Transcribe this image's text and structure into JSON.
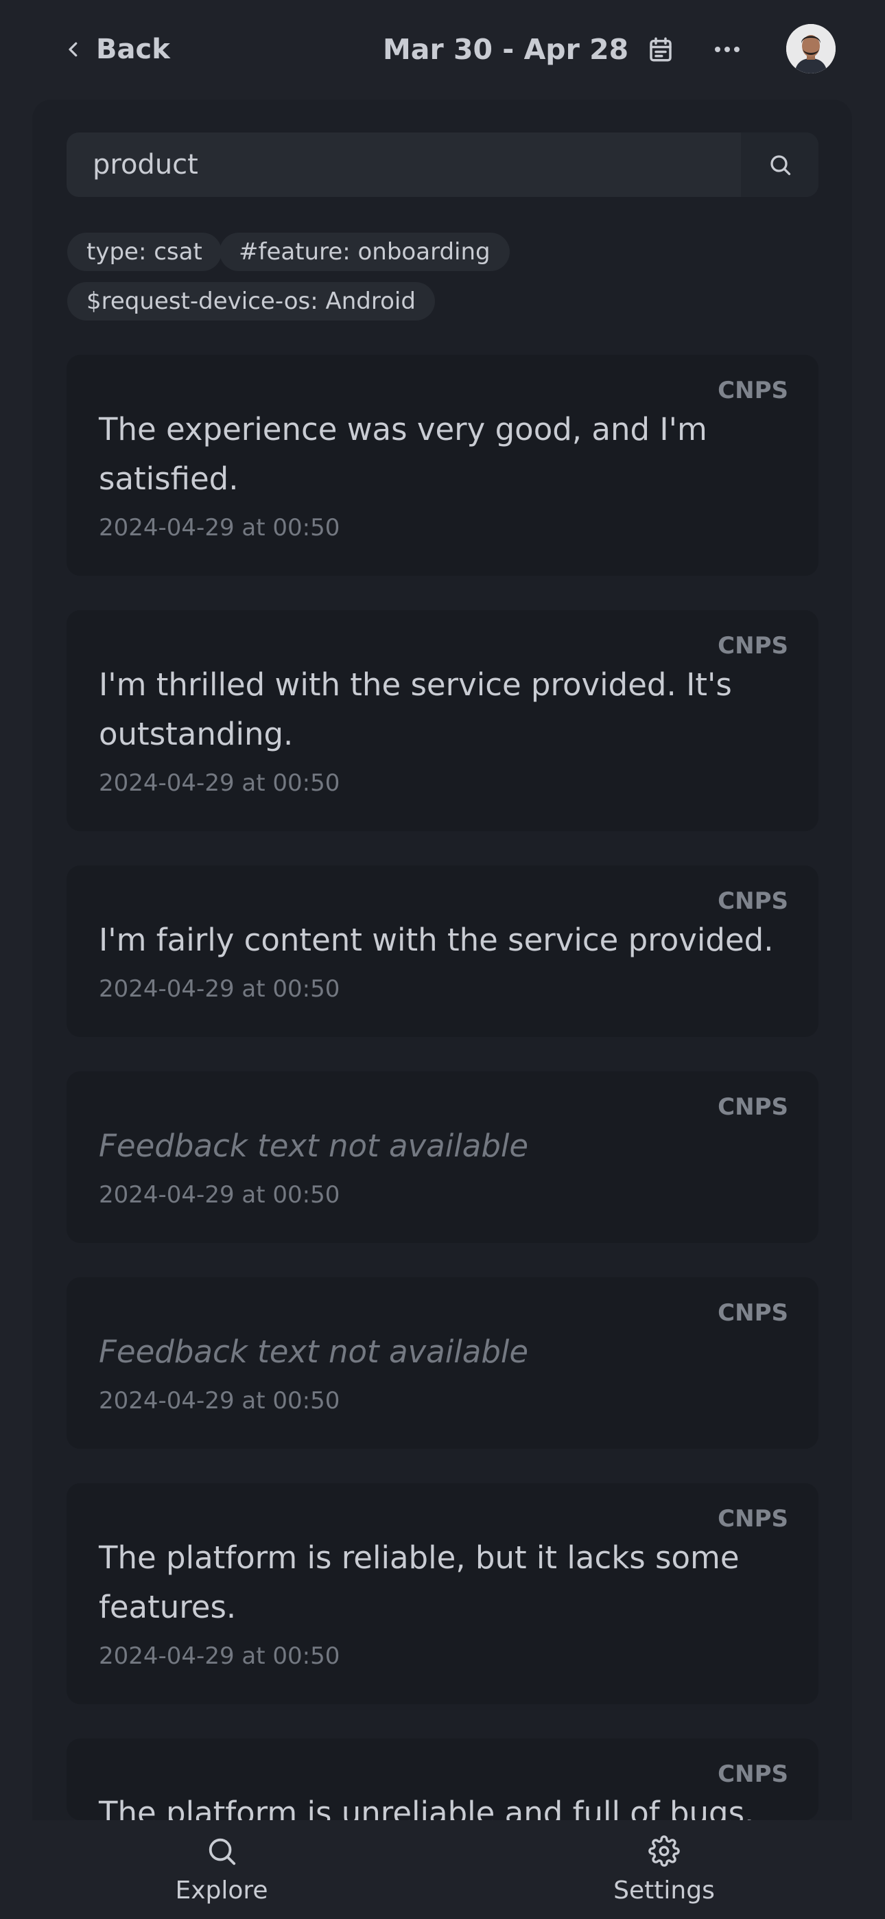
{
  "header": {
    "back_label": "Back",
    "date_range": "Mar 30 - Apr 28"
  },
  "search": {
    "value": "product"
  },
  "filters": [
    "type: csat",
    "#feature: onboarding",
    "$request-device-os: Android"
  ],
  "feedback": [
    {
      "badge": "CNPS",
      "text": "The experience was very good, and I'm satisfied.",
      "date": "2024-04-29 at 00:50"
    },
    {
      "badge": "CNPS",
      "text": "I'm thrilled with the service provided. It's outstanding.",
      "date": "2024-04-29 at 00:50"
    },
    {
      "badge": "CNPS",
      "text": "I'm fairly content with the service provided.",
      "date": "2024-04-29 at 00:50"
    },
    {
      "badge": "CNPS",
      "text": "Feedback text not available",
      "date": "2024-04-29 at 00:50"
    },
    {
      "badge": "CNPS",
      "text": "Feedback text not available",
      "date": "2024-04-29 at 00:50"
    },
    {
      "badge": "CNPS",
      "text": "The platform is reliable, but it lacks some features.",
      "date": "2024-04-29 at 00:50"
    },
    {
      "badge": "CNPS",
      "text": "The platform is unreliable and full of bugs.",
      "date": ""
    }
  ],
  "nav": {
    "explore_label": "Explore",
    "settings_label": "Settings"
  },
  "colors": {
    "background": "#1f2229",
    "card": "#181b21",
    "text": "#c9ccd3",
    "muted": "#737881"
  }
}
